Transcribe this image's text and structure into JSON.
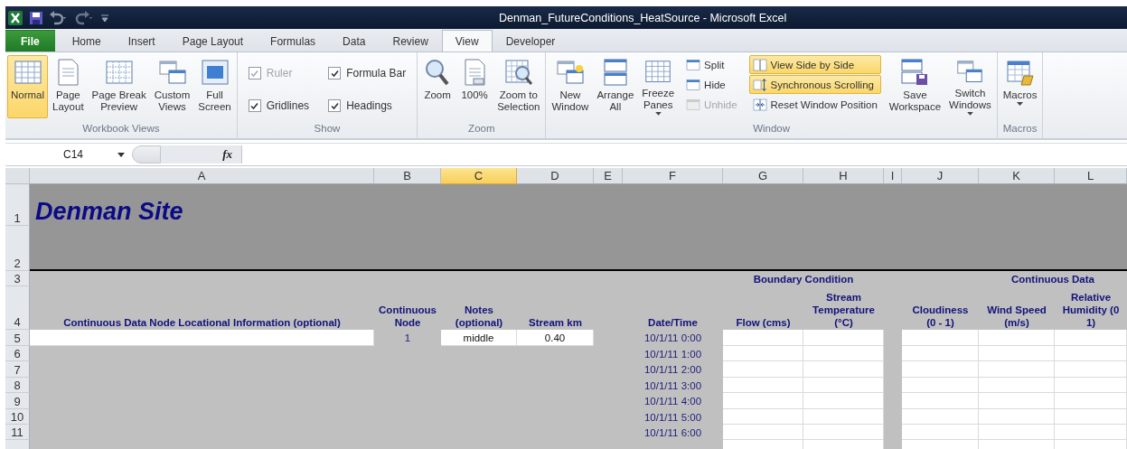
{
  "window": {
    "title": "Denman_FutureConditions_HeatSource - Microsoft Excel"
  },
  "tabs": [
    {
      "label": "File",
      "kind": "file",
      "selected": false
    },
    {
      "label": "Home",
      "kind": "tab",
      "selected": false
    },
    {
      "label": "Insert",
      "kind": "tab",
      "selected": false
    },
    {
      "label": "Page Layout",
      "kind": "tab",
      "selected": false
    },
    {
      "label": "Formulas",
      "kind": "tab",
      "selected": false
    },
    {
      "label": "Data",
      "kind": "tab",
      "selected": false
    },
    {
      "label": "Review",
      "kind": "tab",
      "selected": false
    },
    {
      "label": "View",
      "kind": "tab",
      "selected": true
    },
    {
      "label": "Developer",
      "kind": "tab",
      "selected": false
    }
  ],
  "ribbon": {
    "groups": [
      {
        "label": "Workbook Views",
        "columns": [
          [
            {
              "kind": "large",
              "label": "Normal",
              "selected": true,
              "menu": false
            }
          ],
          [
            {
              "kind": "large",
              "label": "Page\nLayout",
              "selected": false,
              "menu": false
            }
          ],
          [
            {
              "kind": "large",
              "label": "Page Break\nPreview",
              "selected": false,
              "menu": false
            }
          ],
          [
            {
              "kind": "large",
              "label": "Custom\nViews",
              "selected": false,
              "menu": false
            }
          ],
          [
            {
              "kind": "large",
              "label": "Full\nScreen",
              "selected": false,
              "menu": false
            }
          ]
        ]
      },
      {
        "label": "Show",
        "columns": [
          [
            {
              "kind": "check",
              "label": "Ruler",
              "checked": true,
              "disabled": true
            },
            {
              "kind": "check",
              "label": "Gridlines",
              "checked": true,
              "disabled": false
            }
          ],
          [
            {
              "kind": "check",
              "label": "Formula Bar",
              "checked": true,
              "disabled": false
            },
            {
              "kind": "check",
              "label": "Headings",
              "checked": true,
              "disabled": false
            }
          ]
        ]
      },
      {
        "label": "Zoom",
        "columns": [
          [
            {
              "kind": "large",
              "label": "Zoom",
              "selected": false,
              "menu": false
            }
          ],
          [
            {
              "kind": "large",
              "label": "100%",
              "selected": false,
              "menu": false
            }
          ],
          [
            {
              "kind": "large",
              "label": "Zoom to\nSelection",
              "selected": false,
              "menu": false
            }
          ]
        ]
      },
      {
        "label": "Window",
        "columns": [
          [
            {
              "kind": "large",
              "label": "New\nWindow",
              "selected": false,
              "menu": false
            }
          ],
          [
            {
              "kind": "large",
              "label": "Arrange\nAll",
              "selected": false,
              "menu": false
            }
          ],
          [
            {
              "kind": "large",
              "label": "Freeze\nPanes",
              "selected": false,
              "menu": true
            }
          ],
          [
            {
              "kind": "small",
              "label": "Split",
              "selected": false,
              "disabled": false
            },
            {
              "kind": "small",
              "label": "Hide",
              "selected": false,
              "disabled": false
            },
            {
              "kind": "small",
              "label": "Unhide",
              "selected": false,
              "disabled": true
            }
          ],
          [
            {
              "kind": "small",
              "label": "View Side by Side",
              "selected": true,
              "disabled": false
            },
            {
              "kind": "small",
              "label": "Synchronous Scrolling",
              "selected": true,
              "disabled": false
            },
            {
              "kind": "small",
              "label": "Reset Window Position",
              "selected": false,
              "disabled": false
            }
          ],
          [
            {
              "kind": "large",
              "label": "Save\nWorkspace",
              "selected": false,
              "menu": false
            }
          ],
          [
            {
              "kind": "large",
              "label": "Switch\nWindows",
              "selected": false,
              "menu": true
            }
          ]
        ]
      },
      {
        "label": "Macros",
        "columns": [
          [
            {
              "kind": "large",
              "label": "Macros",
              "selected": false,
              "menu": true
            }
          ]
        ]
      }
    ]
  },
  "formula_bar": {
    "name_box": "C14",
    "function_label": "fx"
  },
  "sheet": {
    "columns": [
      {
        "label": "A",
        "selected": false
      },
      {
        "label": "B",
        "selected": false
      },
      {
        "label": "C",
        "selected": true
      },
      {
        "label": "D",
        "selected": false
      },
      {
        "label": "E",
        "selected": false
      },
      {
        "label": "F",
        "selected": false
      },
      {
        "label": "G",
        "selected": false
      },
      {
        "label": "H",
        "selected": false
      },
      {
        "label": "I",
        "selected": false
      },
      {
        "label": "J",
        "selected": false
      },
      {
        "label": "K",
        "selected": false
      },
      {
        "label": "L",
        "selected": false
      }
    ],
    "rows": [
      {
        "number": "1",
        "kind": "banner",
        "cells": [
          {
            "kind": "title",
            "text": "Denman Site"
          }
        ]
      },
      {
        "number": "2",
        "kind": "banner"
      },
      {
        "number": "3",
        "kind": "table",
        "cells": [
          {
            "kind": "blank"
          },
          {
            "kind": "blank"
          },
          {
            "kind": "blank"
          },
          {
            "kind": "blank"
          },
          {
            "kind": "blank"
          },
          {
            "kind": "blank"
          },
          {
            "kind": "group",
            "text": "Boundary Condition"
          },
          {
            "kind": "blank"
          },
          {
            "kind": "blank"
          },
          {
            "kind": "group",
            "text": "Continuous Data"
          }
        ]
      },
      {
        "number": "4",
        "kind": "table",
        "cells": [
          {
            "kind": "heading",
            "text": "Continuous Data Node Locational Information (optional)"
          },
          {
            "kind": "heading",
            "text": "Continuous\nNode"
          },
          {
            "kind": "heading",
            "text": "Notes\n(optional)"
          },
          {
            "kind": "heading",
            "text": "Stream km"
          },
          {
            "kind": "blank"
          },
          {
            "kind": "heading",
            "text": "Date/Time"
          },
          {
            "kind": "heading",
            "text": "Flow (cms)"
          },
          {
            "kind": "heading",
            "text": "Stream\nTemperature\n(°C)"
          },
          {
            "kind": "blank"
          },
          {
            "kind": "heading",
            "text": "Cloudiness\n(0 - 1)"
          },
          {
            "kind": "heading",
            "text": "Wind Speed\n(m/s)"
          },
          {
            "kind": "heading",
            "text": "Relative\nHumidity (0\n1)"
          }
        ]
      },
      {
        "number": "5",
        "kind": "table",
        "cells": [
          {
            "kind": "input"
          },
          {
            "kind": "value",
            "text": "1"
          },
          {
            "kind": "input",
            "text": "middle"
          },
          {
            "kind": "input",
            "text": "0.40"
          },
          {
            "kind": "blank"
          },
          {
            "kind": "label",
            "text": "10/1/11 0:00"
          },
          {
            "kind": "input"
          },
          {
            "kind": "input"
          },
          {
            "kind": "blank"
          },
          {
            "kind": "input"
          },
          {
            "kind": "input"
          },
          {
            "kind": "input"
          }
        ]
      },
      {
        "number": "6",
        "kind": "table",
        "cells": [
          {
            "kind": "blank"
          },
          {
            "kind": "blank"
          },
          {
            "kind": "blank"
          },
          {
            "kind": "blank"
          },
          {
            "kind": "blank"
          },
          {
            "kind": "label",
            "text": "10/1/11 1:00"
          },
          {
            "kind": "input"
          },
          {
            "kind": "input"
          },
          {
            "kind": "blank"
          },
          {
            "kind": "input"
          },
          {
            "kind": "input"
          },
          {
            "kind": "input"
          }
        ]
      },
      {
        "number": "7",
        "kind": "table",
        "cells": [
          {
            "kind": "blank"
          },
          {
            "kind": "blank"
          },
          {
            "kind": "blank"
          },
          {
            "kind": "blank"
          },
          {
            "kind": "blank"
          },
          {
            "kind": "label",
            "text": "10/1/11 2:00"
          },
          {
            "kind": "input"
          },
          {
            "kind": "input"
          },
          {
            "kind": "blank"
          },
          {
            "kind": "input"
          },
          {
            "kind": "input"
          },
          {
            "kind": "input"
          }
        ]
      },
      {
        "number": "8",
        "kind": "table",
        "cells": [
          {
            "kind": "blank"
          },
          {
            "kind": "blank"
          },
          {
            "kind": "blank"
          },
          {
            "kind": "blank"
          },
          {
            "kind": "blank"
          },
          {
            "kind": "label",
            "text": "10/1/11 3:00"
          },
          {
            "kind": "input"
          },
          {
            "kind": "input"
          },
          {
            "kind": "blank"
          },
          {
            "kind": "input"
          },
          {
            "kind": "input"
          },
          {
            "kind": "input"
          }
        ]
      },
      {
        "number": "9",
        "kind": "table",
        "cells": [
          {
            "kind": "blank"
          },
          {
            "kind": "blank"
          },
          {
            "kind": "blank"
          },
          {
            "kind": "blank"
          },
          {
            "kind": "blank"
          },
          {
            "kind": "label",
            "text": "10/1/11 4:00"
          },
          {
            "kind": "input"
          },
          {
            "kind": "input"
          },
          {
            "kind": "blank"
          },
          {
            "kind": "input"
          },
          {
            "kind": "input"
          },
          {
            "kind": "input"
          }
        ]
      },
      {
        "number": "10",
        "kind": "table",
        "cells": [
          {
            "kind": "blank"
          },
          {
            "kind": "blank"
          },
          {
            "kind": "blank"
          },
          {
            "kind": "blank"
          },
          {
            "kind": "blank"
          },
          {
            "kind": "label",
            "text": "10/1/11 5:00"
          },
          {
            "kind": "input"
          },
          {
            "kind": "input"
          },
          {
            "kind": "blank"
          },
          {
            "kind": "input"
          },
          {
            "kind": "input"
          },
          {
            "kind": "input"
          }
        ]
      },
      {
        "number": "11",
        "kind": "table",
        "cells": [
          {
            "kind": "blank"
          },
          {
            "kind": "blank"
          },
          {
            "kind": "blank"
          },
          {
            "kind": "blank"
          },
          {
            "kind": "blank"
          },
          {
            "kind": "label",
            "text": "10/1/11 6:00"
          },
          {
            "kind": "input"
          },
          {
            "kind": "input"
          },
          {
            "kind": "blank"
          },
          {
            "kind": "input"
          },
          {
            "kind": "input"
          },
          {
            "kind": "input"
          }
        ]
      },
      {
        "kind": "table",
        "cells": [
          {
            "kind": "blank"
          },
          {
            "kind": "blank"
          },
          {
            "kind": "blank"
          },
          {
            "kind": "blank"
          },
          {
            "kind": "blank"
          },
          {
            "kind": "label"
          },
          {
            "kind": "input"
          },
          {
            "kind": "input"
          },
          {
            "kind": "blank"
          },
          {
            "kind": "input"
          },
          {
            "kind": "input"
          },
          {
            "kind": "input"
          }
        ]
      }
    ]
  }
}
